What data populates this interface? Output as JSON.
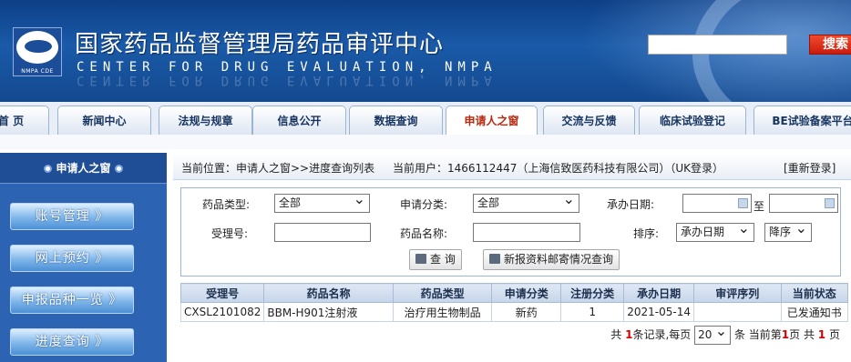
{
  "header": {
    "title_cn": "国家药品监督管理局药品审评中心",
    "title_en": "CENTER FOR DRUG EVALUATION, NMPA",
    "logo_text": "NMPA CDE",
    "search_button": "搜索"
  },
  "nav": {
    "tabs": [
      {
        "label": "首 页"
      },
      {
        "label": "新闻中心"
      },
      {
        "label": "法规与规章"
      },
      {
        "label": "信息公开"
      },
      {
        "label": "数据查询"
      },
      {
        "label": "申请人之窗"
      },
      {
        "label": "交流与反馈"
      },
      {
        "label": "临床试验登记"
      },
      {
        "label": "BE试验备案平台"
      }
    ]
  },
  "sidebar": {
    "heading": "申请人之窗",
    "items": [
      {
        "label": "账号管理 》"
      },
      {
        "label": "网上预约 》"
      },
      {
        "label": "申报品种一览 》"
      },
      {
        "label": "进度查询 》"
      }
    ]
  },
  "breadcrumb": {
    "location": "当前位置：申请人之窗>>进度查询列表",
    "user": "当前用户：1466112447（上海信致医药科技有限公司）（UK登录）",
    "relogin": "[重新登录]"
  },
  "form": {
    "drug_type_label": "药品类型:",
    "drug_type_value": "全部",
    "apply_category_label": "申请分类:",
    "apply_category_value": "全部",
    "date_label": "承办日期:",
    "date_to": "至",
    "accept_no_label": "受理号:",
    "drug_name_label": "药品名称:",
    "sort_label": "排序:",
    "sort_field_value": "承办日期",
    "sort_order_value": "降序",
    "query_button": "查 询",
    "mail_button": "新报资料邮寄情况查询"
  },
  "table": {
    "columns": [
      "受理号",
      "药品名称",
      "药品类型",
      "申请分类",
      "注册分类",
      "承办日期",
      "审评序列",
      "当前状态"
    ],
    "rows": [
      [
        "CXSL2101082",
        "BBM-H901注射液",
        "治疗用生物制品",
        "新药",
        "1",
        "2021-05-14",
        "",
        "已发通知书"
      ]
    ]
  },
  "pager": {
    "prefix": "共",
    "total": "1",
    "records_text": "条记录,每页",
    "page_size": "20",
    "current_prefix": "条 当前第",
    "current": "1",
    "of_text": "页 共",
    "pages": "1",
    "suffix": "页"
  }
}
